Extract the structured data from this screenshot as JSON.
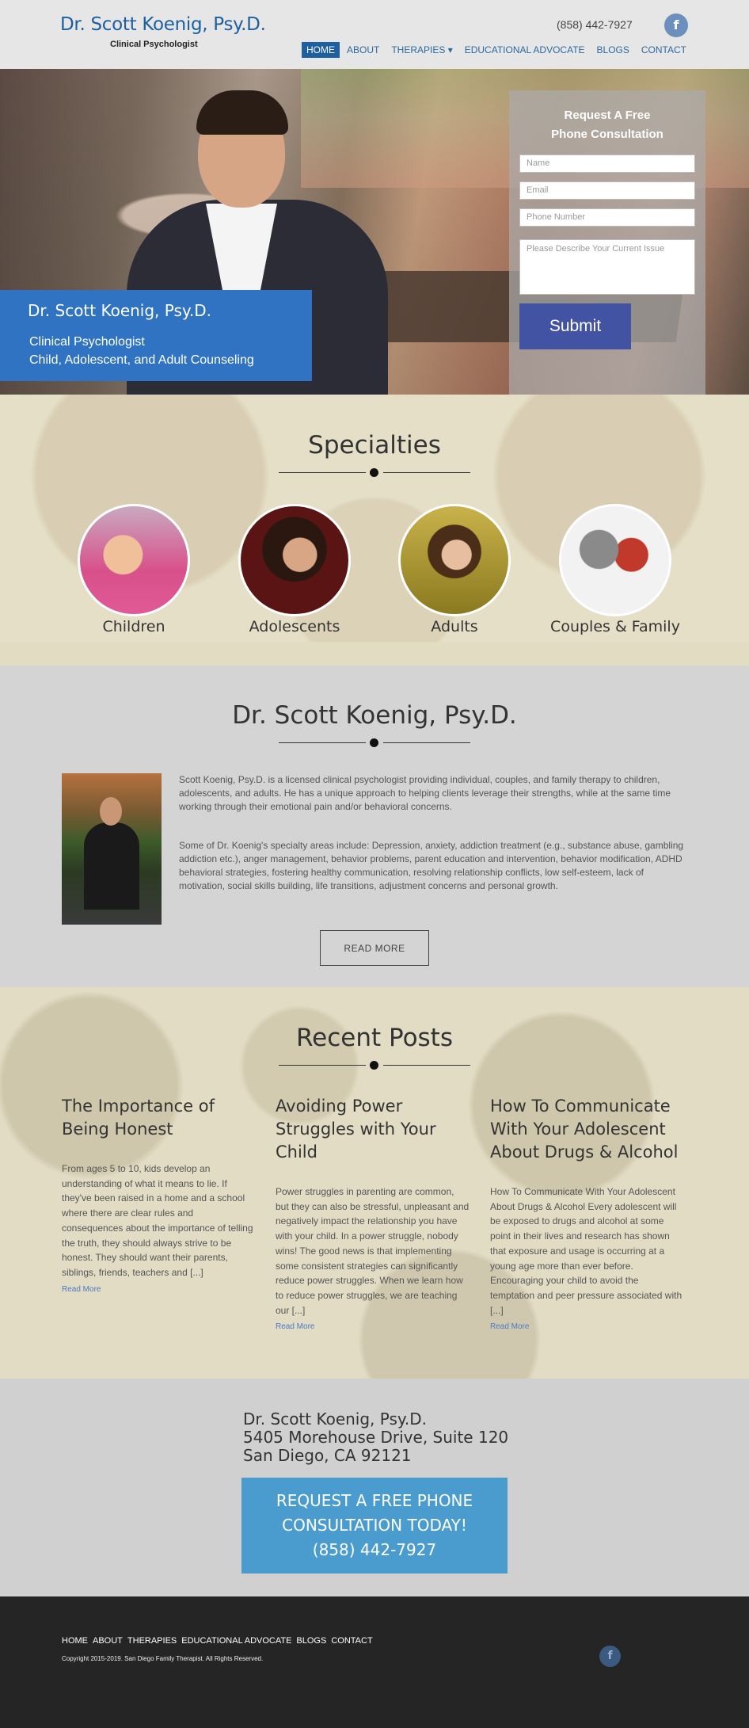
{
  "header": {
    "logo_title": "Dr. Scott Koenig, Psy.D.",
    "logo_subtitle": "Clinical Psychologist",
    "phone": "(858) 442-7927",
    "facebook_icon": "facebook-icon",
    "nav": [
      {
        "label": "HOME",
        "active": true
      },
      {
        "label": "ABOUT",
        "active": false
      },
      {
        "label": "THERAPIES ▾",
        "active": false
      },
      {
        "label": "EDUCATIONAL ADVOCATE",
        "active": false
      },
      {
        "label": "BLOGS",
        "active": false
      },
      {
        "label": "CONTACT",
        "active": false
      }
    ]
  },
  "hero": {
    "name": "Dr. Scott Koenig, Psy.D.",
    "line1": "Clinical Psychologist",
    "line2": "Child, Adolescent, and Adult Counseling"
  },
  "form": {
    "title_line1": "Request A Free",
    "title_line2": "Phone Consultation",
    "name_placeholder": "Name",
    "email_placeholder": "Email",
    "phone_placeholder": "Phone Number",
    "issue_placeholder": "Please Describe Your Current Issue",
    "submit_label": "Submit"
  },
  "specialties": {
    "title": "Specialties",
    "items": [
      {
        "label": "Children",
        "color": "#d8508a"
      },
      {
        "label": "Adolescents",
        "color": "#5a1414"
      },
      {
        "label": "Adults",
        "color": "#8a7a20"
      },
      {
        "label": "Couples & Family",
        "color": "#d8d8d8"
      }
    ]
  },
  "about": {
    "title": "Dr. Scott Koenig, Psy.D.",
    "para1": "Scott Koenig, Psy.D. is a licensed clinical psychologist providing individual, couples, and family therapy to children, adolescents, and adults. He has a unique approach to helping clients leverage their strengths, while at the same time working through their emotional pain and/or behavioral concerns.",
    "para2": "Some of Dr. Koenig's specialty areas include: Depression, anxiety, addiction treatment (e.g., substance abuse, gambling addiction etc.), anger management, behavior problems, parent education and intervention, behavior modification, ADHD behavioral strategies, fostering healthy communication, resolving relationship conflicts, low self-esteem, lack of motivation, social skills building, life transitions, adjustment concerns and personal growth.",
    "read_more": "READ MORE"
  },
  "posts": {
    "title": "Recent Posts",
    "items": [
      {
        "title": "The Importance of Being Honest",
        "body": "From ages 5 to 10, kids develop an understanding of what it means to lie. If they've been raised in a home and a school where there are clear rules and consequences about the importance of telling the truth, they should always strive to be honest. They should want their parents, siblings, friends, teachers and [...]",
        "link": "Read More"
      },
      {
        "title": "Avoiding Power Struggles with Your Child",
        "body": "Power struggles in parenting are common, but they can also be stressful, unpleasant and negatively impact the relationship you have with your child. In a power struggle, nobody wins! The good news is that implementing some consistent strategies can significantly reduce power struggles. When we learn how to reduce power struggles, we are teaching our [...]",
        "link": "Read More"
      },
      {
        "title": "How To Communicate With Your Adolescent About Drugs & Alcohol",
        "body": "How To Communicate With Your Adolescent About Drugs & Alcohol Every adolescent will be exposed to drugs and alcohol at some point in their lives and research has shown that exposure and usage is occurring at a young age more than ever before. Encouraging your child to avoid the temptation and peer pressure associated with [...]",
        "link": "Read More"
      }
    ]
  },
  "contact": {
    "name": "Dr. Scott Koenig, Psy.D.",
    "street": "5405 Morehouse Drive, Suite 120",
    "city": "San Diego, CA 92121",
    "cta_line1": "REQUEST A FREE PHONE",
    "cta_line2": "CONSULTATION TODAY!",
    "cta_line3": "(858) 442-7927"
  },
  "footer": {
    "nav": [
      "HOME",
      "ABOUT",
      "THERAPIES",
      "EDUCATIONAL ADVOCATE",
      "BLOGS",
      "CONTACT"
    ],
    "copyright": "Copyright 2015-2019. San Diego Family Therapist. All Rights Reserved.",
    "facebook_icon": "facebook-icon"
  },
  "colors": {
    "brand_blue": "#1e5fa0",
    "hero_caption": "#2f73c2",
    "submit": "#4353a3",
    "cta": "#4a9ccf",
    "footer": "#252525"
  }
}
